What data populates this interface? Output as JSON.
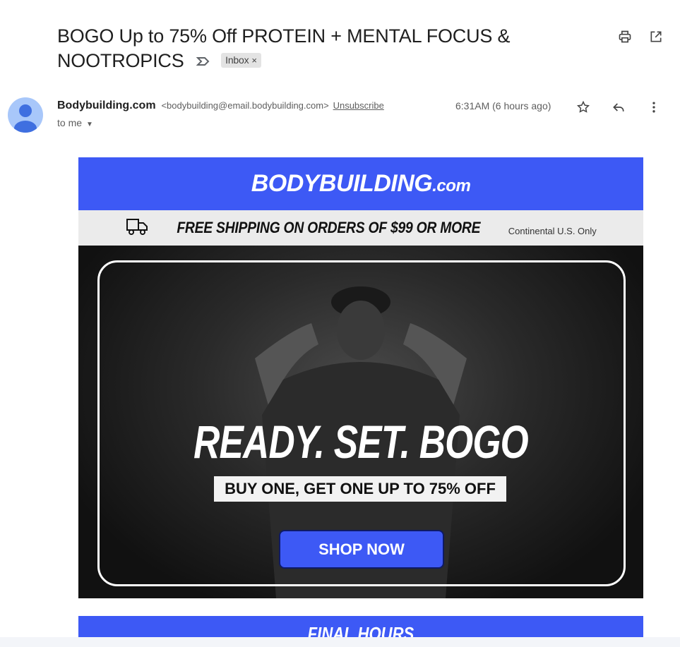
{
  "email": {
    "subject": "BOGO Up to 75% Off PROTEIN + MENTAL FOCUS & NOOTROPICS",
    "label": "Inbox",
    "label_remove": "×",
    "sender_name": "Bodybuilding.com",
    "sender_email": "<bodybuilding@email.bodybuilding.com>",
    "unsubscribe": "Unsubscribe",
    "recipient": "to me",
    "time": "6:31AM (6 hours ago)"
  },
  "icons": {
    "importance": "importance-marker-icon",
    "print": "print-icon",
    "open_new_window": "open-in-new-window-icon",
    "star": "star-icon",
    "reply": "reply-icon",
    "more": "more-vert-icon",
    "truck": "delivery-truck-icon"
  },
  "body": {
    "brand_main": "BODYBUILDING",
    "brand_suffix": ".com",
    "shipping_text": "FREE SHIPPING ON ORDERS OF $99 OR MORE",
    "shipping_note": "Continental U.S. Only",
    "hero_title": "READY. SET. BOGO",
    "hero_subtitle": "BUY ONE, GET ONE UP TO 75% OFF",
    "cta": "SHOP NOW",
    "next_banner": "FINAL HOURS"
  },
  "colors": {
    "brand_blue": "#3d59f5",
    "shipping_bg": "#ebebeb",
    "hero_bg": "#141414"
  }
}
